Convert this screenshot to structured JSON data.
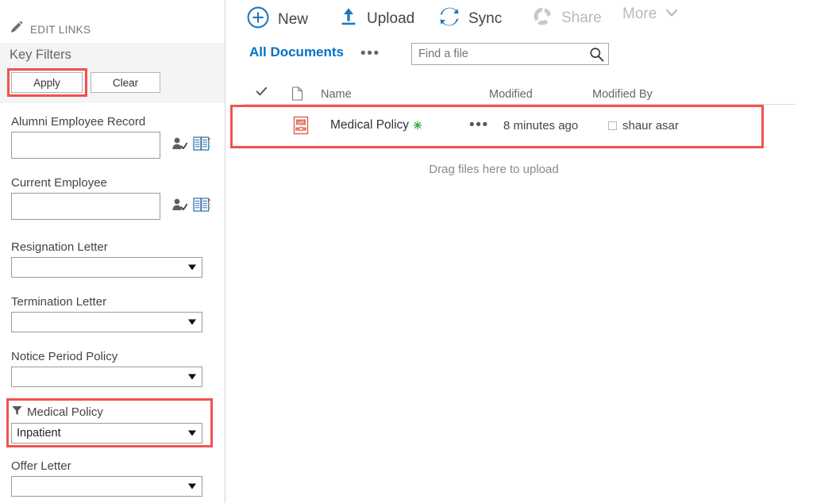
{
  "sidebar": {
    "edit_links": {
      "label": "EDIT LINKS",
      "icon": "pencil-icon"
    },
    "key_filters_title": "Key Filters",
    "apply_label": "Apply",
    "clear_label": "Clear",
    "fields": [
      {
        "label": "Alumni Employee Record",
        "type": "people",
        "value": "",
        "icons": [
          "check-names-icon",
          "browse-address-book-icon"
        ]
      },
      {
        "label": "Current Employee",
        "type": "people",
        "value": "",
        "icons": [
          "check-names-icon",
          "browse-address-book-icon"
        ]
      },
      {
        "label": "Resignation Letter",
        "type": "select",
        "value": ""
      },
      {
        "label": "Termination Letter",
        "type": "select",
        "value": ""
      },
      {
        "label": "Notice Period Policy",
        "type": "select",
        "value": ""
      },
      {
        "label": "Medical Policy",
        "type": "select",
        "value": "Inpatient",
        "filtered": true,
        "icon": "filter-funnel-icon"
      },
      {
        "label": "Offer Letter",
        "type": "select",
        "value": ""
      }
    ]
  },
  "toolbar": {
    "items": [
      {
        "label": "New",
        "icon": "plus-circle-icon",
        "disabled": false
      },
      {
        "label": "Upload",
        "icon": "upload-arrow-icon",
        "disabled": false
      },
      {
        "label": "Sync",
        "icon": "sync-arrows-icon",
        "disabled": false
      },
      {
        "label": "Share",
        "icon": "share-people-icon",
        "disabled": true
      },
      {
        "label": "More",
        "icon": "chevron-down-icon",
        "disabled": true
      }
    ]
  },
  "view_bar": {
    "current_view": "All Documents",
    "ellipsis": "•••",
    "search_placeholder": "Find a file",
    "search_value": "",
    "search_icon": "search-icon"
  },
  "list": {
    "columns": [
      {
        "label": "",
        "icon": "checkmark-icon"
      },
      {
        "label": "",
        "icon": "document-type-icon"
      },
      {
        "label": "Name"
      },
      {
        "label": "Modified"
      },
      {
        "label": "Modified By"
      }
    ],
    "rows": [
      {
        "file_icon": "pdf-file-icon",
        "name": "Medical Policy",
        "new_badge": "✳",
        "ellipsis": "•••",
        "modified": "8 minutes ago",
        "modified_by": "shaur asar",
        "presence": "presence-offline-icon"
      }
    ],
    "drop_hint": "Drag files here to upload"
  },
  "colors": {
    "accent_blue": "#0072c6",
    "annotation_red": "#f0534f",
    "new_badge_green": "#3faa3f",
    "panel_grey": "#f4f4f4"
  }
}
